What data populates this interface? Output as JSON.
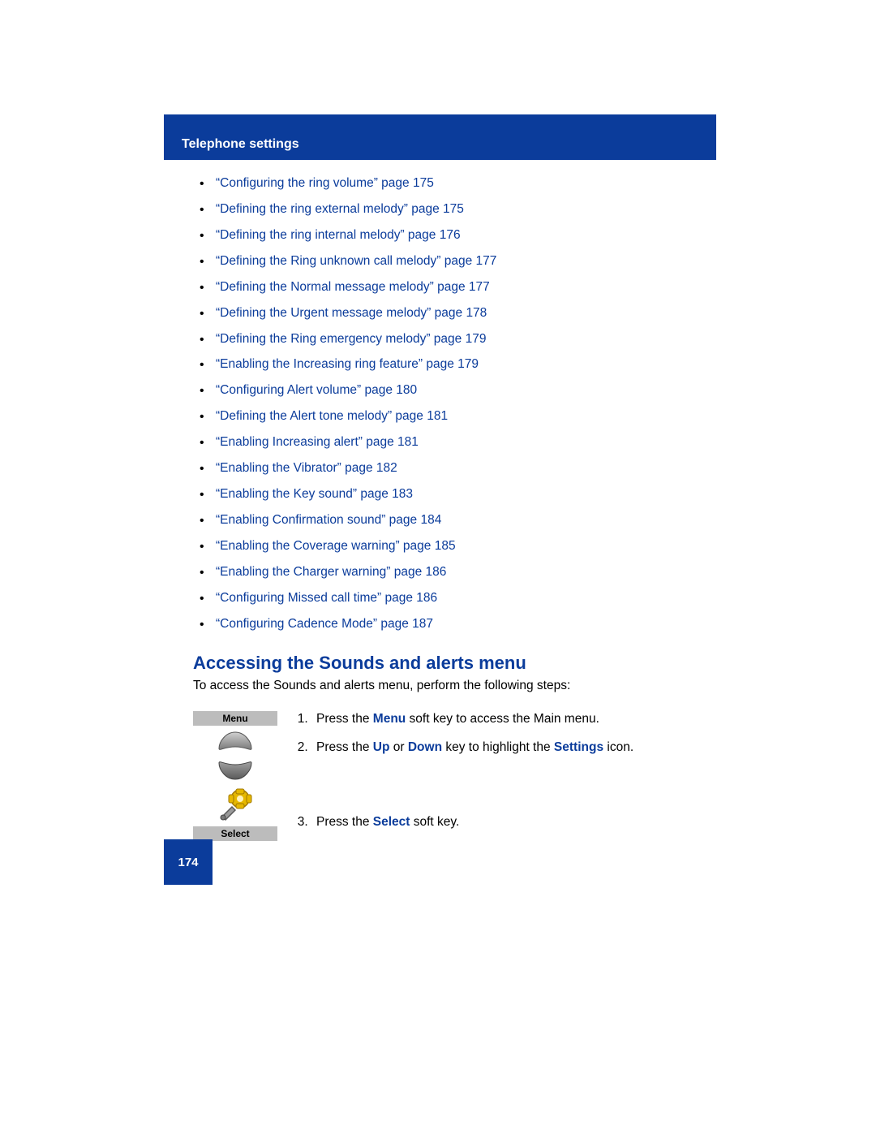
{
  "header": {
    "title": "Telephone settings"
  },
  "links": [
    "“Configuring the ring volume” page 175",
    "“Defining the ring external melody” page 175",
    "“Defining the ring internal melody” page 176",
    "“Defining the Ring unknown call melody” page 177",
    "“Defining the Normal message melody” page 177",
    "“Defining the Urgent message melody” page 178",
    "“Defining the Ring emergency melody” page 179",
    "“Enabling the Increasing ring feature” page 179",
    "“Configuring Alert volume” page 180",
    "“Defining the Alert tone melody” page 181",
    "“Enabling Increasing alert” page 181",
    "“Enabling the Vibrator” page 182",
    "“Enabling the Key sound” page 183",
    "“Enabling Confirmation sound” page 184",
    "“Enabling the Coverage warning” page 185",
    "“Enabling the Charger warning” page 186",
    "“Configuring Missed call time” page 186",
    "“Configuring Cadence Mode” page 187"
  ],
  "section": {
    "heading": "Accessing the Sounds and alerts menu",
    "intro": "To access the Sounds and alerts menu, perform the following steps:"
  },
  "labels": {
    "menu": "Menu",
    "select": "Select"
  },
  "steps": {
    "s1_a": "Press the ",
    "s1_b": "Menu",
    "s1_c": " soft key to access the Main menu.",
    "s2_a": "Press the ",
    "s2_b": "Up",
    "s2_c": " or ",
    "s2_d": "Down",
    "s2_e": " key to highlight the ",
    "s2_f": "Settings",
    "s2_g": " icon.",
    "s3_a": "Press the ",
    "s3_b": "Select",
    "s3_c": " soft key."
  },
  "page_number": "174"
}
